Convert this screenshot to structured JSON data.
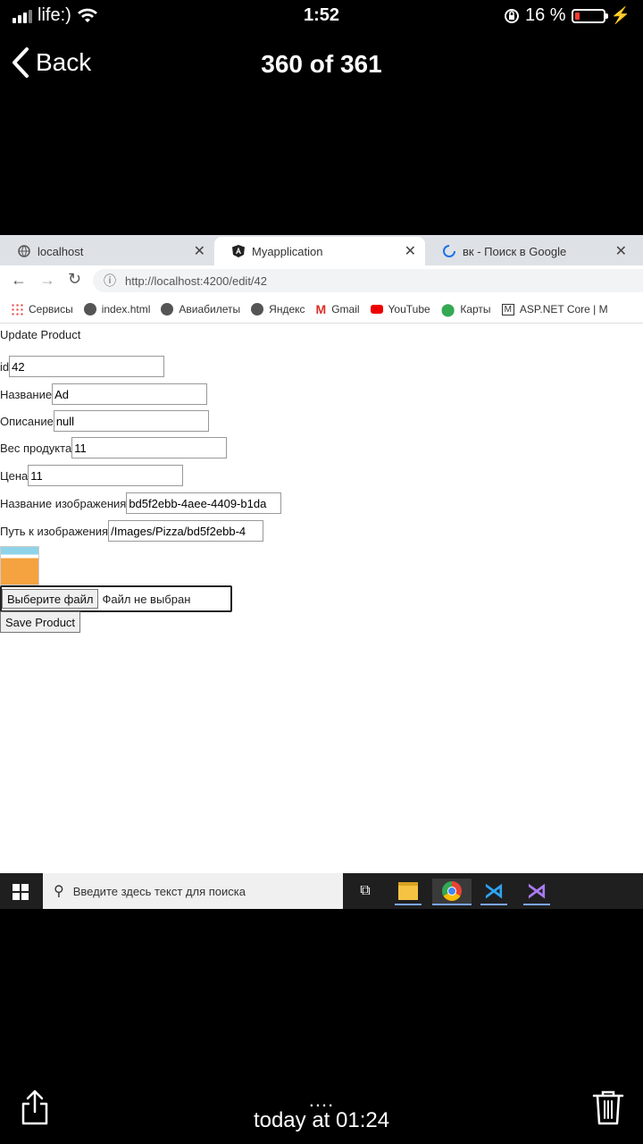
{
  "status": {
    "carrier": "life:)",
    "time": "1:52",
    "battery_percent": "16 %",
    "battery_level": 0.16
  },
  "viewer": {
    "back_label": "Back",
    "counter": "360 of 361",
    "footer_dots": "....",
    "footer_time": "today at 01:24"
  },
  "browser": {
    "tabs": [
      {
        "title": "localhost",
        "active": false
      },
      {
        "title": "Myapplication",
        "active": true
      },
      {
        "title": "вк - Поиск в Google",
        "active": false
      }
    ],
    "url": "http://localhost:4200/edit/42",
    "bookmarks": [
      "Сервисы",
      "index.html",
      "Авиабилеты",
      "Яндекс",
      "Gmail",
      "YouTube",
      "Карты",
      "ASP.NET Core | M"
    ]
  },
  "form": {
    "title": "Update Product",
    "fields": [
      {
        "label": "id",
        "value": "42"
      },
      {
        "label": "Название",
        "value": "Ad"
      },
      {
        "label": "Описание",
        "value": "null"
      },
      {
        "label": "Вес продукта",
        "value": "11"
      },
      {
        "label": "Цена",
        "value": "11"
      },
      {
        "label": "Название изображения",
        "value": "bd5f2ebb-4aee-4409-b1da"
      },
      {
        "label": "Путь к изображения",
        "value": "/Images/Pizza/bd5f2ebb-4"
      }
    ],
    "file_button": "Выберите файл",
    "file_status": "Файл не выбран",
    "save_button": "Save Product"
  },
  "taskbar": {
    "search_placeholder": "Введите здесь текст для поиска"
  }
}
